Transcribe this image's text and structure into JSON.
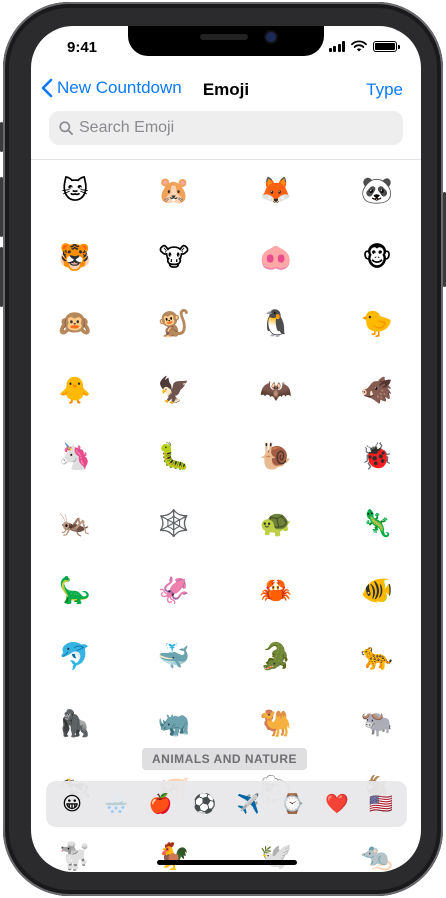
{
  "status_bar": {
    "time": "9:41"
  },
  "nav": {
    "back_label": "New Countdown",
    "title": "Emoji",
    "type_label": "Type"
  },
  "search": {
    "placeholder": "Search Emoji"
  },
  "emoji_grid": [
    [
      "🐱",
      "🐹",
      "🦊",
      "🐼"
    ],
    [
      "🐯",
      "🐮",
      "🐽",
      "🐵"
    ],
    [
      "🙉",
      "🐒",
      "🐧",
      "🐤"
    ],
    [
      "🐥",
      "🦅",
      "🦇",
      "🐗"
    ],
    [
      "🦄",
      "🐛",
      "🐌",
      "🐞"
    ],
    [
      "🦗",
      "🕸️",
      "🐢",
      "🦎"
    ],
    [
      "🦕",
      "🦑",
      "🦀",
      "🐠"
    ],
    [
      "🐬",
      "🐳",
      "🐊",
      "🐆"
    ],
    [
      "🦍",
      "🦏",
      "🐫",
      "🐃"
    ],
    [
      "🐄",
      "🐖",
      "🐑",
      "🐐"
    ],
    [
      "🐩",
      "🐓",
      "🕊️",
      "🐀"
    ]
  ],
  "category_label": "ANIMALS AND NATURE",
  "categories": [
    {
      "icon": "😀",
      "name": "smileys"
    },
    {
      "icon": "🌨️",
      "name": "animals-nature"
    },
    {
      "icon": "🍎",
      "name": "food-drink"
    },
    {
      "icon": "⚽",
      "name": "activity"
    },
    {
      "icon": "✈️",
      "name": "travel-places"
    },
    {
      "icon": "⌚",
      "name": "objects"
    },
    {
      "icon": "❤️",
      "name": "symbols"
    },
    {
      "icon": "🇺🇸",
      "name": "flags"
    }
  ],
  "colors": {
    "accent": "#0a7aff",
    "search_bg": "#eeeeef",
    "frame": "#2b2b2d"
  }
}
